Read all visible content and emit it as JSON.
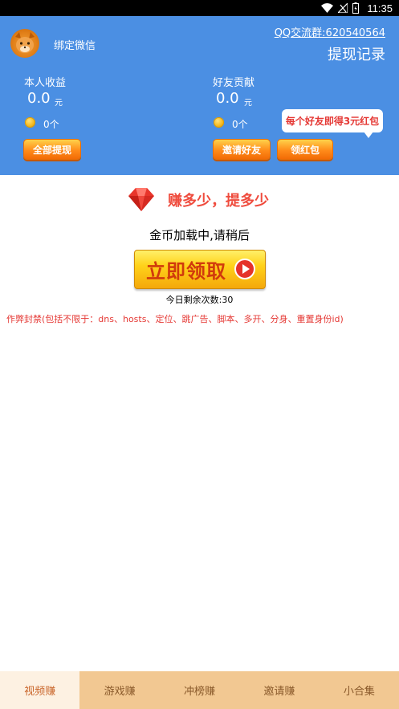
{
  "status_bar": {
    "time": "11:35",
    "icons": [
      "wifi-icon",
      "no-signal-icon",
      "battery-icon"
    ]
  },
  "header": {
    "bind_wechat": "绑定微信",
    "qq_group": "QQ交流群:620540564",
    "withdraw_record": "提现记录",
    "my_earnings": {
      "label": "本人收益",
      "amount": "0.0",
      "unit": "元",
      "coins": "0个",
      "button": "全部提现"
    },
    "friend_contribution": {
      "label": "好友贡献",
      "amount": "0.0",
      "unit": "元",
      "coins": "0个",
      "invite_button": "邀请好友",
      "red_packet_button": "领红包"
    },
    "bubble": "每个好友即得3元红包",
    "colors": {
      "header_bg": "#4b8fe3",
      "button_orange": "#ff8c1a",
      "bubble_text": "#e53935"
    }
  },
  "main": {
    "slogan": "赚多少，提多少",
    "loading_text": "金币加载中,请稍后",
    "claim_button": "立即领取",
    "remaining_today": "今日剩余次数:30",
    "warning": "作弊封禁(包括不限于：dns、hosts、定位、跳广告、脚本、多开、分身、重置身份id)"
  },
  "tabs": [
    {
      "label": "视频赚",
      "active": true
    },
    {
      "label": "游戏赚",
      "active": false
    },
    {
      "label": "冲榜赚",
      "active": false
    },
    {
      "label": "邀请赚",
      "active": false
    },
    {
      "label": "小合集",
      "active": false
    }
  ]
}
